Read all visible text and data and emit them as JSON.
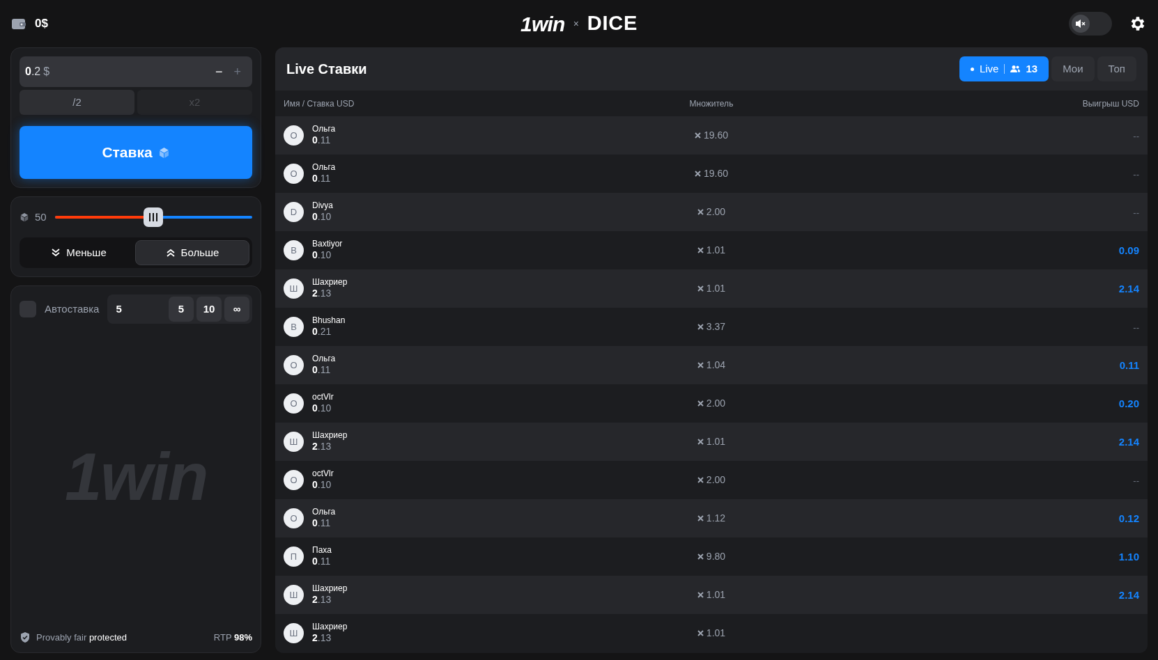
{
  "header": {
    "balance": "0$",
    "logo": "1win",
    "logo_separator": "×",
    "game": "DICE",
    "sound_on": false
  },
  "bet": {
    "amount": "**0**.2",
    "currency": "$",
    "minus": "−",
    "plus": "+",
    "half": "/2",
    "double": "x2",
    "double_disabled": true,
    "submit": "Ставка"
  },
  "roll": {
    "value": "50",
    "level": 0.5,
    "directions": [
      {
        "label": "Меньше",
        "kind": "down",
        "selected": false
      },
      {
        "label": "Больше",
        "kind": "up",
        "selected": true
      }
    ]
  },
  "auto": {
    "label": "Автоставка",
    "checked": false,
    "count": "5",
    "presets": [
      "5",
      "10",
      "∞"
    ]
  },
  "watermark_logo": "1win",
  "footer": {
    "fair": "Provably fair",
    "fair_strong": "protected",
    "rtp_label": "RTP",
    "rtp_value": "98%"
  },
  "live": {
    "title": "Live Ставки",
    "tabs": [
      {
        "label": "Live",
        "count": "13",
        "kind": "live",
        "selected": true
      },
      {
        "label": "Мои",
        "kind": "plain",
        "selected": false
      },
      {
        "label": "Топ",
        "kind": "plain",
        "selected": false
      }
    ],
    "columns": [
      "Имя / Ставка USD",
      "Множитель",
      "Выигрыш USD"
    ],
    "rows": [
      {
        "initial": "О",
        "name": "Ольга",
        "stake": "**0**.11",
        "multiplier": "19.60",
        "win": "--",
        "won": false
      },
      {
        "initial": "О",
        "name": "Ольга",
        "stake": "**0**.11",
        "multiplier": "19.60",
        "win": "--",
        "won": false
      },
      {
        "initial": "D",
        "name": "Divya",
        "stake": "**0**.10",
        "multiplier": "2.00",
        "win": "--",
        "won": false
      },
      {
        "initial": "B",
        "name": "Baxtiyor",
        "stake": "**0**.10",
        "multiplier": "1.01",
        "win": "0.09",
        "won": true
      },
      {
        "initial": "Ш",
        "name": "Шахриер",
        "stake": "**2**.13",
        "multiplier": "1.01",
        "win": "2.14",
        "won": true
      },
      {
        "initial": "B",
        "name": "Bhushan",
        "stake": "**0**.21",
        "multiplier": "3.37",
        "win": "--",
        "won": false
      },
      {
        "initial": "О",
        "name": "Ольга",
        "stake": "**0**.11",
        "multiplier": "1.04",
        "win": "0.11",
        "won": true
      },
      {
        "initial": "O",
        "name": "octVlr",
        "stake": "**0**.10",
        "multiplier": "2.00",
        "win": "0.20",
        "won": true
      },
      {
        "initial": "Ш",
        "name": "Шахриер",
        "stake": "**2**.13",
        "multiplier": "1.01",
        "win": "2.14",
        "won": true
      },
      {
        "initial": "O",
        "name": "octVlr",
        "stake": "**0**.10",
        "multiplier": "2.00",
        "win": "--",
        "won": false
      },
      {
        "initial": "О",
        "name": "Ольга",
        "stake": "**0**.11",
        "multiplier": "1.12",
        "win": "0.12",
        "won": true
      },
      {
        "initial": "П",
        "name": "Паха",
        "stake": "**0**.11",
        "multiplier": "9.80",
        "win": "1.10",
        "won": true
      },
      {
        "initial": "Ш",
        "name": "Шахриер",
        "stake": "**2**.13",
        "multiplier": "1.01",
        "win": "2.14",
        "won": true
      },
      {
        "initial": "Ш",
        "name": "Шахриер",
        "stake": "**2**.13",
        "multiplier": "1.01"
      }
    ]
  }
}
